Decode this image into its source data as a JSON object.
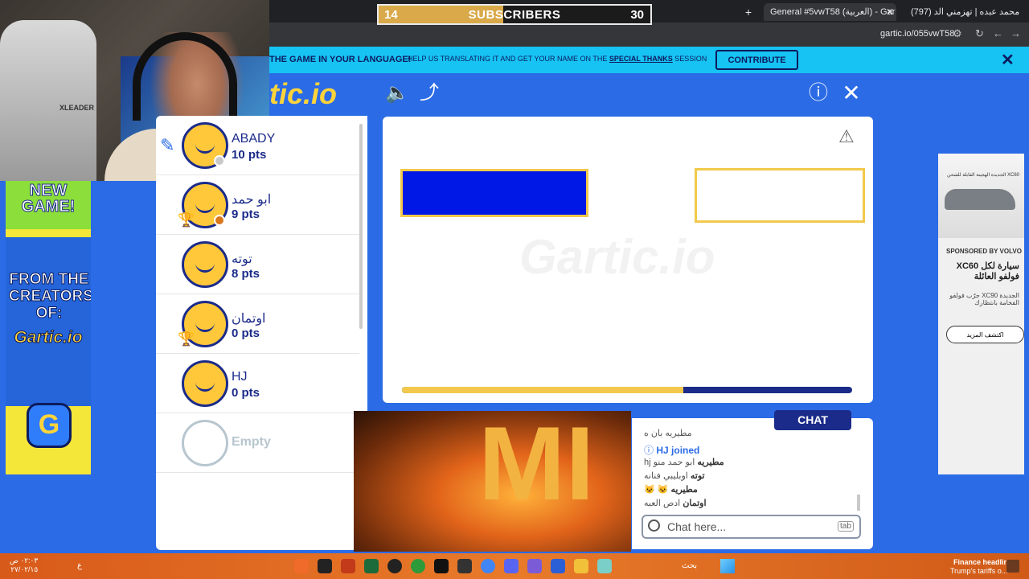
{
  "browser": {
    "tabs": [
      {
        "label": "General #5vwT58 (العربية) - Gar"
      },
      {
        "label": "(797) محمد عبده | تهزمني الد"
      }
    ],
    "url": "gartic.io/055vwT58"
  },
  "stream_overlay": {
    "subscribers_current": "14",
    "subscribers_label": "SUBSCRIBERS",
    "subscribers_goal": "30",
    "progress_fraction": 0.46
  },
  "banner": {
    "lead": "THE GAME IN YOUR LANGUAGE!",
    "text_before": "HELP US TRANSLATING IT AND GET YOUR NAME ON THE",
    "link": "SPECIAL THANKS",
    "text_after": "SESSION",
    "button_label": "CONTRIBUTE",
    "close_label": "✕"
  },
  "header": {
    "logo": "tic.io",
    "sound_icon": "🔈",
    "share_icon": "⤴",
    "info_icon": "ⓘ",
    "close_icon": "✕"
  },
  "webcam": {
    "chair_brand": "XLEADER"
  },
  "left_ad": {
    "headline": "NEW GAME!",
    "from": "FROM THE CREATORS OF:",
    "brand": "Gartic.io",
    "app_letter": "G"
  },
  "players": [
    {
      "name": "ABADY",
      "points": "10 pts",
      "status_color": "#c9c9c9",
      "drawing": true,
      "trophy": false,
      "empty": false
    },
    {
      "name": "ابو حمد",
      "points": "9 pts",
      "status_color": "#d9781a",
      "drawing": false,
      "trophy": true,
      "empty": false
    },
    {
      "name": "توته",
      "points": "8 pts",
      "status_color": null,
      "drawing": false,
      "trophy": false,
      "empty": false
    },
    {
      "name": "اوتمان",
      "points": "0 pts",
      "status_color": null,
      "drawing": false,
      "trophy": true,
      "empty": false
    },
    {
      "name": "HJ",
      "points": "0 pts",
      "status_color": null,
      "drawing": false,
      "trophy": false,
      "empty": false
    },
    {
      "name": "Empty",
      "points": "",
      "status_color": null,
      "drawing": false,
      "trophy": false,
      "empty": true
    }
  ],
  "board": {
    "watermark": "Gartic.io",
    "timer_fraction": 0.625,
    "brush_color": "#0018e6",
    "frame_color": "#f2c94c"
  },
  "chat": {
    "tab_label": "CHAT",
    "lines": [
      {
        "author": "",
        "text": "مطيريه بان ه"
      },
      {
        "author": "",
        "text": "HJ joined",
        "joined": true
      },
      {
        "author": "مطيريه",
        "text": "ابو حمد منو hj"
      },
      {
        "author": "توته",
        "text": "اوبليبي فنانه"
      },
      {
        "author": "مطيريه",
        "text": "😺 😺"
      },
      {
        "author": "اوتمان",
        "text": "ادص العبه"
      }
    ],
    "input_placeholder": "Chat here...",
    "tab_hint": "tab"
  },
  "video": {
    "letters": "MI"
  },
  "right_ad": {
    "car_title": "XC60 الجديدة الهجينة القابلة للشحن",
    "sponsor": "SPONSORED BY VOLVO",
    "headline": "سيارة لكل XC60 فولفو العائلة",
    "description": "الجديدة XC90 جرّب فولفو الفخامة بانتظارك",
    "cta": "اكتشف المزيد"
  },
  "taskbar": {
    "time": "٠٢:٠٣ ص",
    "date": "٢٧/٠٢/١٥",
    "lang": "ع",
    "search_label": "بحث",
    "news_title": "Finance headline",
    "news_sub": "Trump's tariffs o..."
  }
}
